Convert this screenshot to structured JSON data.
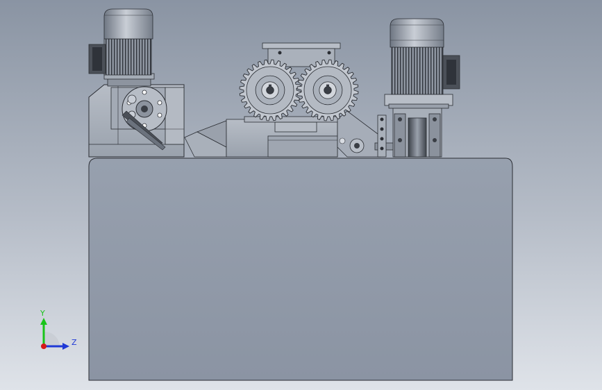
{
  "triad": {
    "y_label": "Y",
    "z_label": "Z",
    "y_color": "#19c419",
    "z_color": "#1f39d6",
    "origin_color": "#d41818"
  },
  "colors": {
    "metal": "#a9b0bb",
    "metal_dark": "#7f8793",
    "base_top": "#939cab",
    "base_bottom": "#8d96a5",
    "line": "#2a2d33"
  },
  "icons": {
    "triad": "coordinate-triad-icon",
    "gear": "gear-icon",
    "motor": "motor-icon"
  }
}
